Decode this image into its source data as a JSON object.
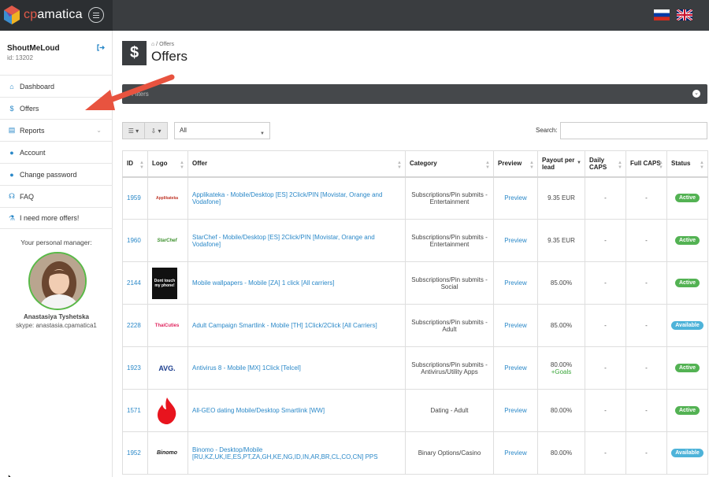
{
  "app": {
    "brand_prefix": "cp",
    "brand_suffix": "amatica"
  },
  "user": {
    "name": "ShoutMeLoud",
    "id_text": "id: 13202"
  },
  "sidebar": {
    "items": [
      {
        "label": "Dashboard",
        "icon": "home-icon"
      },
      {
        "label": "Offers",
        "icon": "dollar-icon"
      },
      {
        "label": "Reports",
        "icon": "report-icon"
      },
      {
        "label": "Account",
        "icon": "user-icon"
      },
      {
        "label": "Change password",
        "icon": "user-lock-icon"
      },
      {
        "label": "FAQ",
        "icon": "faq-icon"
      },
      {
        "label": "I need more offers!",
        "icon": "flask-icon"
      }
    ],
    "manager_title": "Your personal manager:",
    "manager_name": "Anastasiya Tyshetska",
    "manager_skype": "skype: anastasia.cpamatica1"
  },
  "page": {
    "breadcrumb": "Offers",
    "title": "Offers",
    "icon_glyph": "$",
    "filter_label": "Filters"
  },
  "toolbar": {
    "select_value": "All",
    "search_label": "Search:",
    "search_value": ""
  },
  "table": {
    "headers": {
      "id": "ID",
      "logo": "Logo",
      "offer": "Offer",
      "category": "Category",
      "preview": "Preview",
      "payout": "Payout per lead",
      "daily": "Daily CAPS",
      "full": "Full CAPS",
      "status": "Status"
    },
    "rows": [
      {
        "id": "1959",
        "logo": "Applikateka",
        "offer": "Applikateka - Mobile/Desktop [ES] 2Click/PIN [Movistar, Orange and Vodafone]",
        "category": "Subscriptions/Pin submits - Entertainment",
        "preview": "Preview",
        "payout": "9.35 EUR",
        "payout_extra": "",
        "daily": "-",
        "full": "-",
        "status": "Active",
        "status_type": "active"
      },
      {
        "id": "1960",
        "logo": "StarChef",
        "offer": "StarChef - Mobile/Desktop [ES] 2Click/PIN [Movistar, Orange and Vodafone]",
        "category": "Subscriptions/Pin submits - Entertainment",
        "preview": "Preview",
        "payout": "9.35 EUR",
        "payout_extra": "",
        "daily": "-",
        "full": "-",
        "status": "Active",
        "status_type": "active"
      },
      {
        "id": "2144",
        "logo": "Dont touch my phone!",
        "offer": "Mobile wallpapers - Mobile [ZA] 1 click [All carriers]",
        "category": "Subscriptions/Pin submits - Social",
        "preview": "Preview",
        "payout": "85.00%",
        "payout_extra": "",
        "daily": "-",
        "full": "-",
        "status": "Active",
        "status_type": "active"
      },
      {
        "id": "2228",
        "logo": "ThaiCuties",
        "offer": "Adult Campaign Smartlink - Mobile [TH] 1Click/2Click [All Carriers]",
        "category": "Subscriptions/Pin submits - Adult",
        "preview": "Preview",
        "payout": "85.00%",
        "payout_extra": "",
        "daily": "-",
        "full": "-",
        "status": "Available",
        "status_type": "available"
      },
      {
        "id": "1923",
        "logo": "AVG.",
        "offer": "Antivirus 8 - Mobile [MX] 1Click [Telcel]",
        "category": "Subscriptions/Pin submits - Antivirus/Utility Apps",
        "preview": "Preview",
        "payout": "80.00%",
        "payout_extra": "+Goals",
        "daily": "-",
        "full": "-",
        "status": "Active",
        "status_type": "active"
      },
      {
        "id": "1571",
        "logo": "",
        "offer": "All-GEO dating Mobile/Desktop Smartlink [WW]",
        "category": "Dating - Adult",
        "preview": "Preview",
        "payout": "80.00%",
        "payout_extra": "",
        "daily": "-",
        "full": "-",
        "status": "Active",
        "status_type": "active"
      },
      {
        "id": "1952",
        "logo": "Binomo",
        "offer": "Binomo - Desktop/Mobile [RU,KZ,UK,IE,ES,PT,ZA,GH,KE,NG,ID,IN,AR,BR,CL,CO,CN] PPS",
        "category": "Binary Options/Casino",
        "preview": "Preview",
        "payout": "80.00%",
        "payout_extra": "",
        "daily": "-",
        "full": "-",
        "status": "Available",
        "status_type": "available"
      }
    ]
  },
  "colors": {
    "topbar": "#3a3d40",
    "link": "#2a88c8",
    "active": "#53b253",
    "available": "#4eb3d9",
    "arrow": "#e8533f"
  }
}
